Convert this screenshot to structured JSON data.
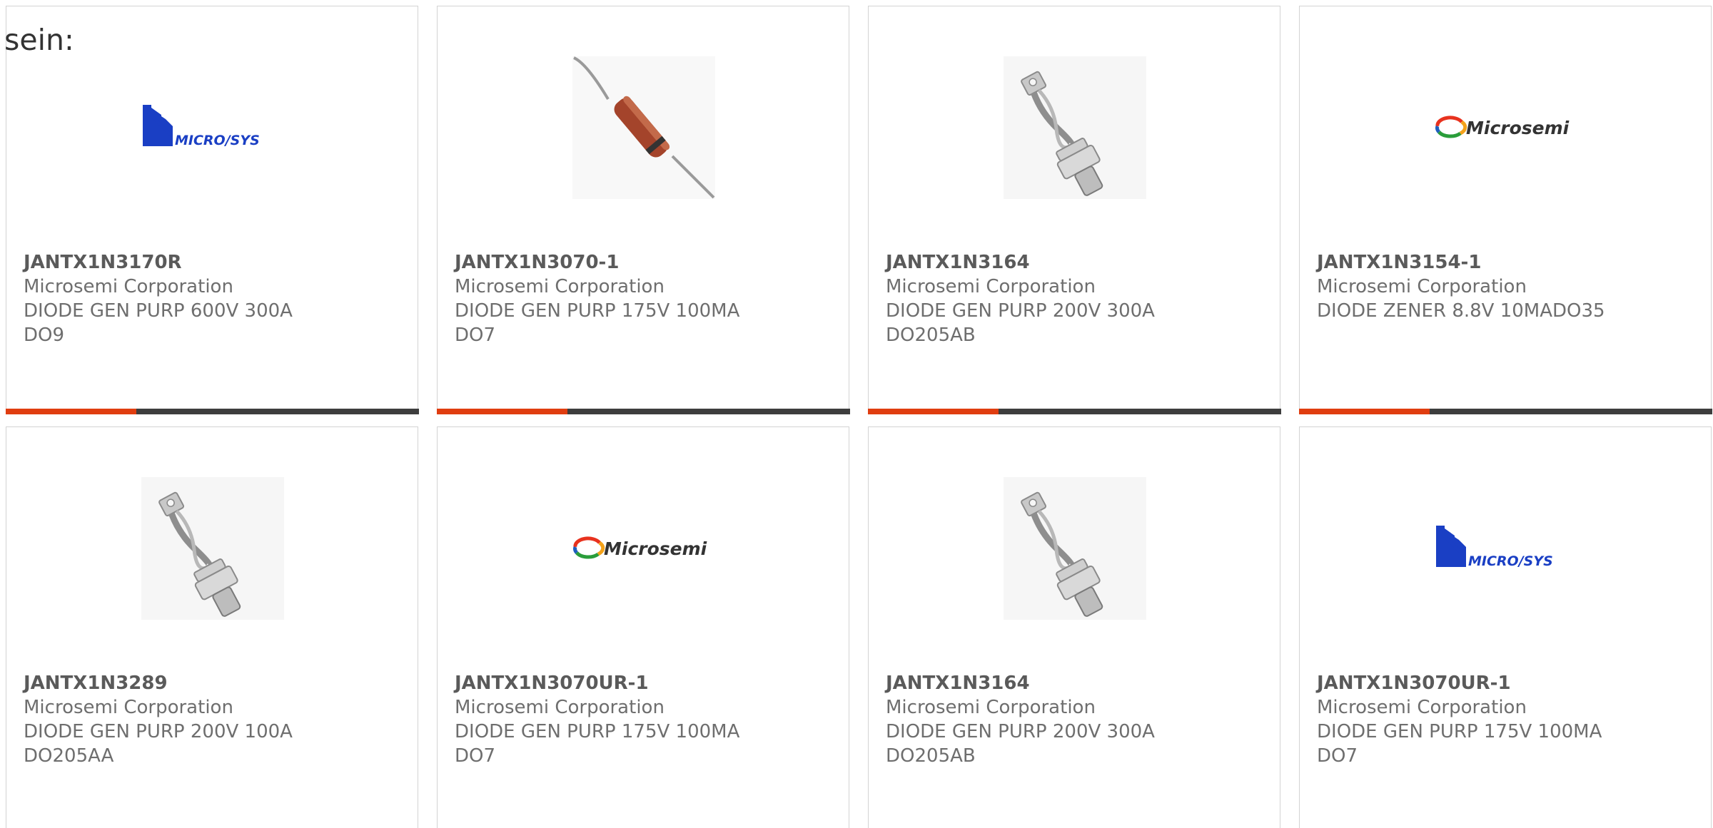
{
  "intro_text": "sein:",
  "colors": {
    "accent": "#e03d10",
    "bar": "#3d3d3d",
    "text": "#6e6e6e",
    "border": "#d3d3d3"
  },
  "products": [
    {
      "part_number": "JANTX1N3170R",
      "manufacturer": "Microsemi Corporation",
      "description": "DIODE GEN PURP 600V 300A",
      "package": "DO9",
      "image": "microsys-logo-icon"
    },
    {
      "part_number": "JANTX1N3070-1",
      "manufacturer": "Microsemi Corporation",
      "description": "DIODE GEN PURP 175V 100MA",
      "package": "DO7",
      "image": "axial-diode-icon"
    },
    {
      "part_number": "JANTX1N3164",
      "manufacturer": "Microsemi Corporation",
      "description": "DIODE GEN PURP 200V 300A",
      "package": "DO205AB",
      "image": "stud-diode-icon"
    },
    {
      "part_number": "JANTX1N3154-1",
      "manufacturer": "Microsemi Corporation",
      "description": "DIODE ZENER 8.8V 10MADO35",
      "package": "",
      "image": "microsemi-logo-icon"
    },
    {
      "part_number": "JANTX1N3289",
      "manufacturer": "Microsemi Corporation",
      "description": "DIODE GEN PURP 200V 100A",
      "package": "DO205AA",
      "image": "stud-diode-icon"
    },
    {
      "part_number": "JANTX1N3070UR-1",
      "manufacturer": "Microsemi Corporation",
      "description": "DIODE GEN PURP 175V 100MA",
      "package": "DO7",
      "image": "microsemi-logo-icon"
    },
    {
      "part_number": "JANTX1N3164",
      "manufacturer": "Microsemi Corporation",
      "description": "DIODE GEN PURP 200V 300A",
      "package": "DO205AB",
      "image": "stud-diode-icon"
    },
    {
      "part_number": "JANTX1N3070UR-1",
      "manufacturer": "Microsemi Corporation",
      "description": "DIODE GEN PURP 175V 100MA",
      "package": "DO7",
      "image": "microsys-logo-icon"
    }
  ]
}
